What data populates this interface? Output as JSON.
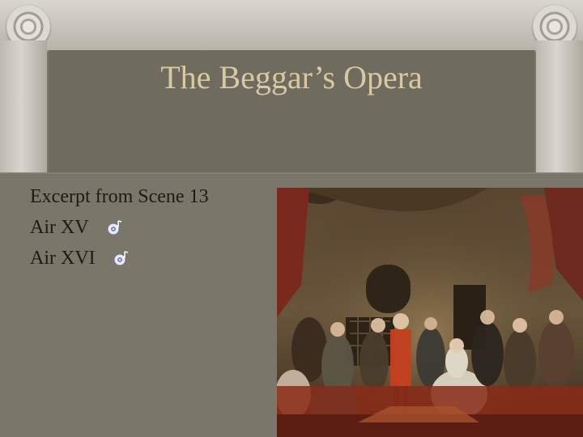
{
  "slide": {
    "title": "The Beggar’s Opera",
    "bullets": [
      {
        "label": "Excerpt from Scene 13",
        "has_sound": false
      },
      {
        "label": "Air XV",
        "has_sound": true,
        "icon": "sound-clip-icon"
      },
      {
        "label": "Air XVI",
        "has_sound": true,
        "icon": "sound-clip-icon"
      }
    ]
  },
  "image": {
    "depicts": "painting-stage-scene"
  },
  "colors": {
    "background": "#7a776a",
    "title": "#d9c9a0",
    "text": "#1d1b16"
  }
}
